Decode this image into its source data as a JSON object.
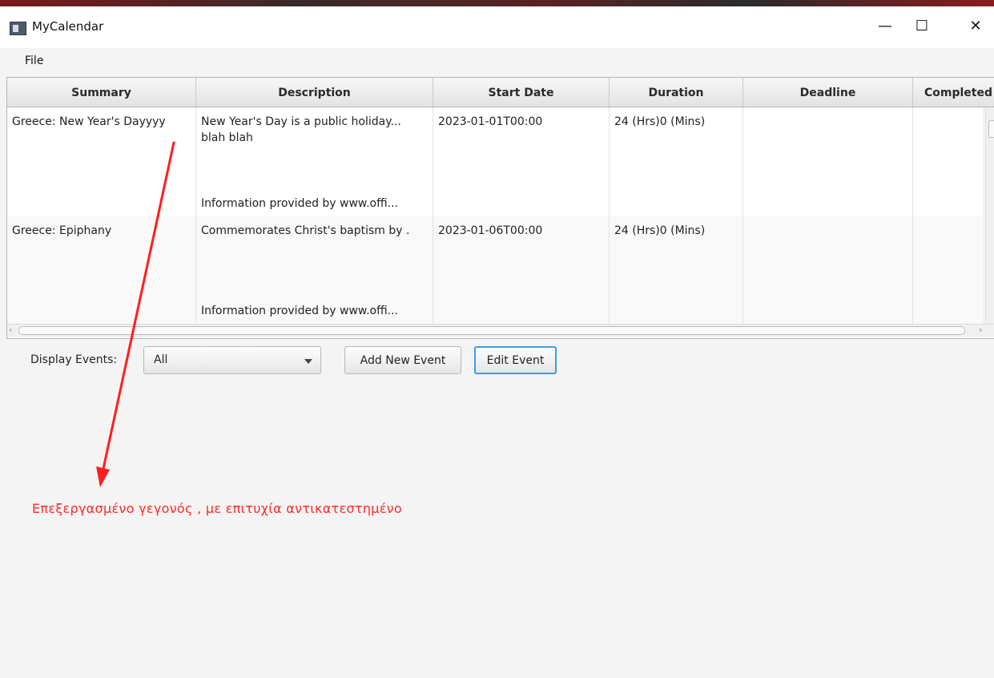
{
  "window": {
    "title": "MyCalendar",
    "controls": {
      "minimize": "—",
      "maximize": "☐",
      "close": "✕"
    }
  },
  "menu": {
    "items": [
      "File"
    ]
  },
  "table": {
    "columns": [
      "Summary",
      "Description",
      "Start Date",
      "Duration",
      "Deadline",
      "Completed"
    ],
    "rows": [
      {
        "summary": "Greece: New Year's Dayyyy",
        "description_line1": "New Year's Day is a public holiday...",
        "description_line2": "blah blah",
        "description_info": "Information provided by www.offi...",
        "start_date": "2023-01-01T00:00",
        "duration": "24 (Hrs)0 (Mins)",
        "deadline": "",
        "completed": ""
      },
      {
        "summary": "Greece: Epiphany",
        "description_line1": "Commemorates Christ's baptism by .",
        "description_line2": "",
        "description_info": "Information provided by www.offi...",
        "start_date": "2023-01-06T00:00",
        "duration": "24 (Hrs)0 (Mins)",
        "deadline": "",
        "completed": ""
      }
    ]
  },
  "controls": {
    "display_label": "Display Events:",
    "display_value": "All",
    "add_button": "Add New Event",
    "edit_button": "Edit Event"
  },
  "annotation": {
    "message": "Επεξεργασμένο γεγονός , με επιτυχία αντικατεστημένο",
    "color": "#ff2a2a"
  }
}
